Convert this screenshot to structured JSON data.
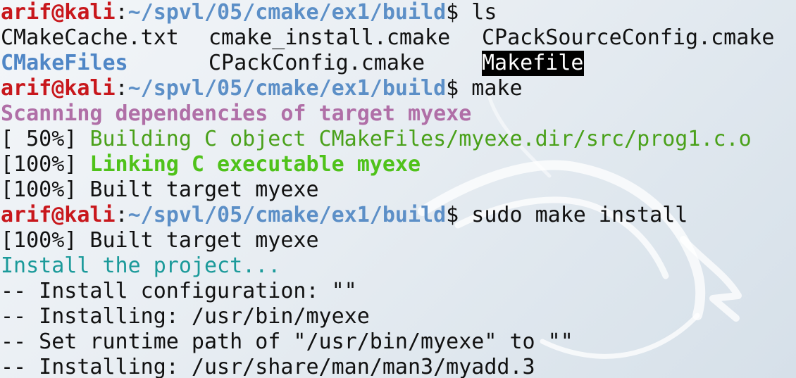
{
  "colors": {
    "user": "#c8171c",
    "path": "#5c8fc7",
    "directory": "#4f86c6",
    "scan": "#b06fa7",
    "building": "#4aa11a",
    "linking": "#4fc21a",
    "install": "#1b9a9a",
    "text": "#111111"
  },
  "prompt": {
    "user_host": "arif@kali",
    "colon": ":",
    "path": "~/spvl/05/cmake/ex1/build",
    "symbol": "$"
  },
  "commands": {
    "ls": " ls",
    "make": " make",
    "install": " sudo make install"
  },
  "ls_output": {
    "row1": [
      "CMakeCache.txt",
      "cmake_install.cmake",
      "CPackSourceConfig.cmake"
    ],
    "row2": [
      "CMakeFiles",
      "CPackConfig.cmake",
      "Makefile"
    ]
  },
  "make_output": {
    "scanning": "Scanning dependencies of target myexe",
    "building_prefix": "[ 50%] ",
    "building": "Building C object CMakeFiles/myexe.dir/src/prog1.c.o",
    "linking_prefix": "[100%] ",
    "linking": "Linking C executable myexe",
    "built": "[100%] Built target myexe"
  },
  "install_output": {
    "built": "[100%] Built target myexe",
    "install_project": "Install the project...",
    "config": "-- Install configuration: \"\"",
    "installing_bin": "-- Installing: /usr/bin/myexe",
    "runtime_path": "-- Set runtime path of \"/usr/bin/myexe\" to \"\"",
    "installing_man": "-- Installing: /usr/share/man/man3/myadd.3"
  }
}
